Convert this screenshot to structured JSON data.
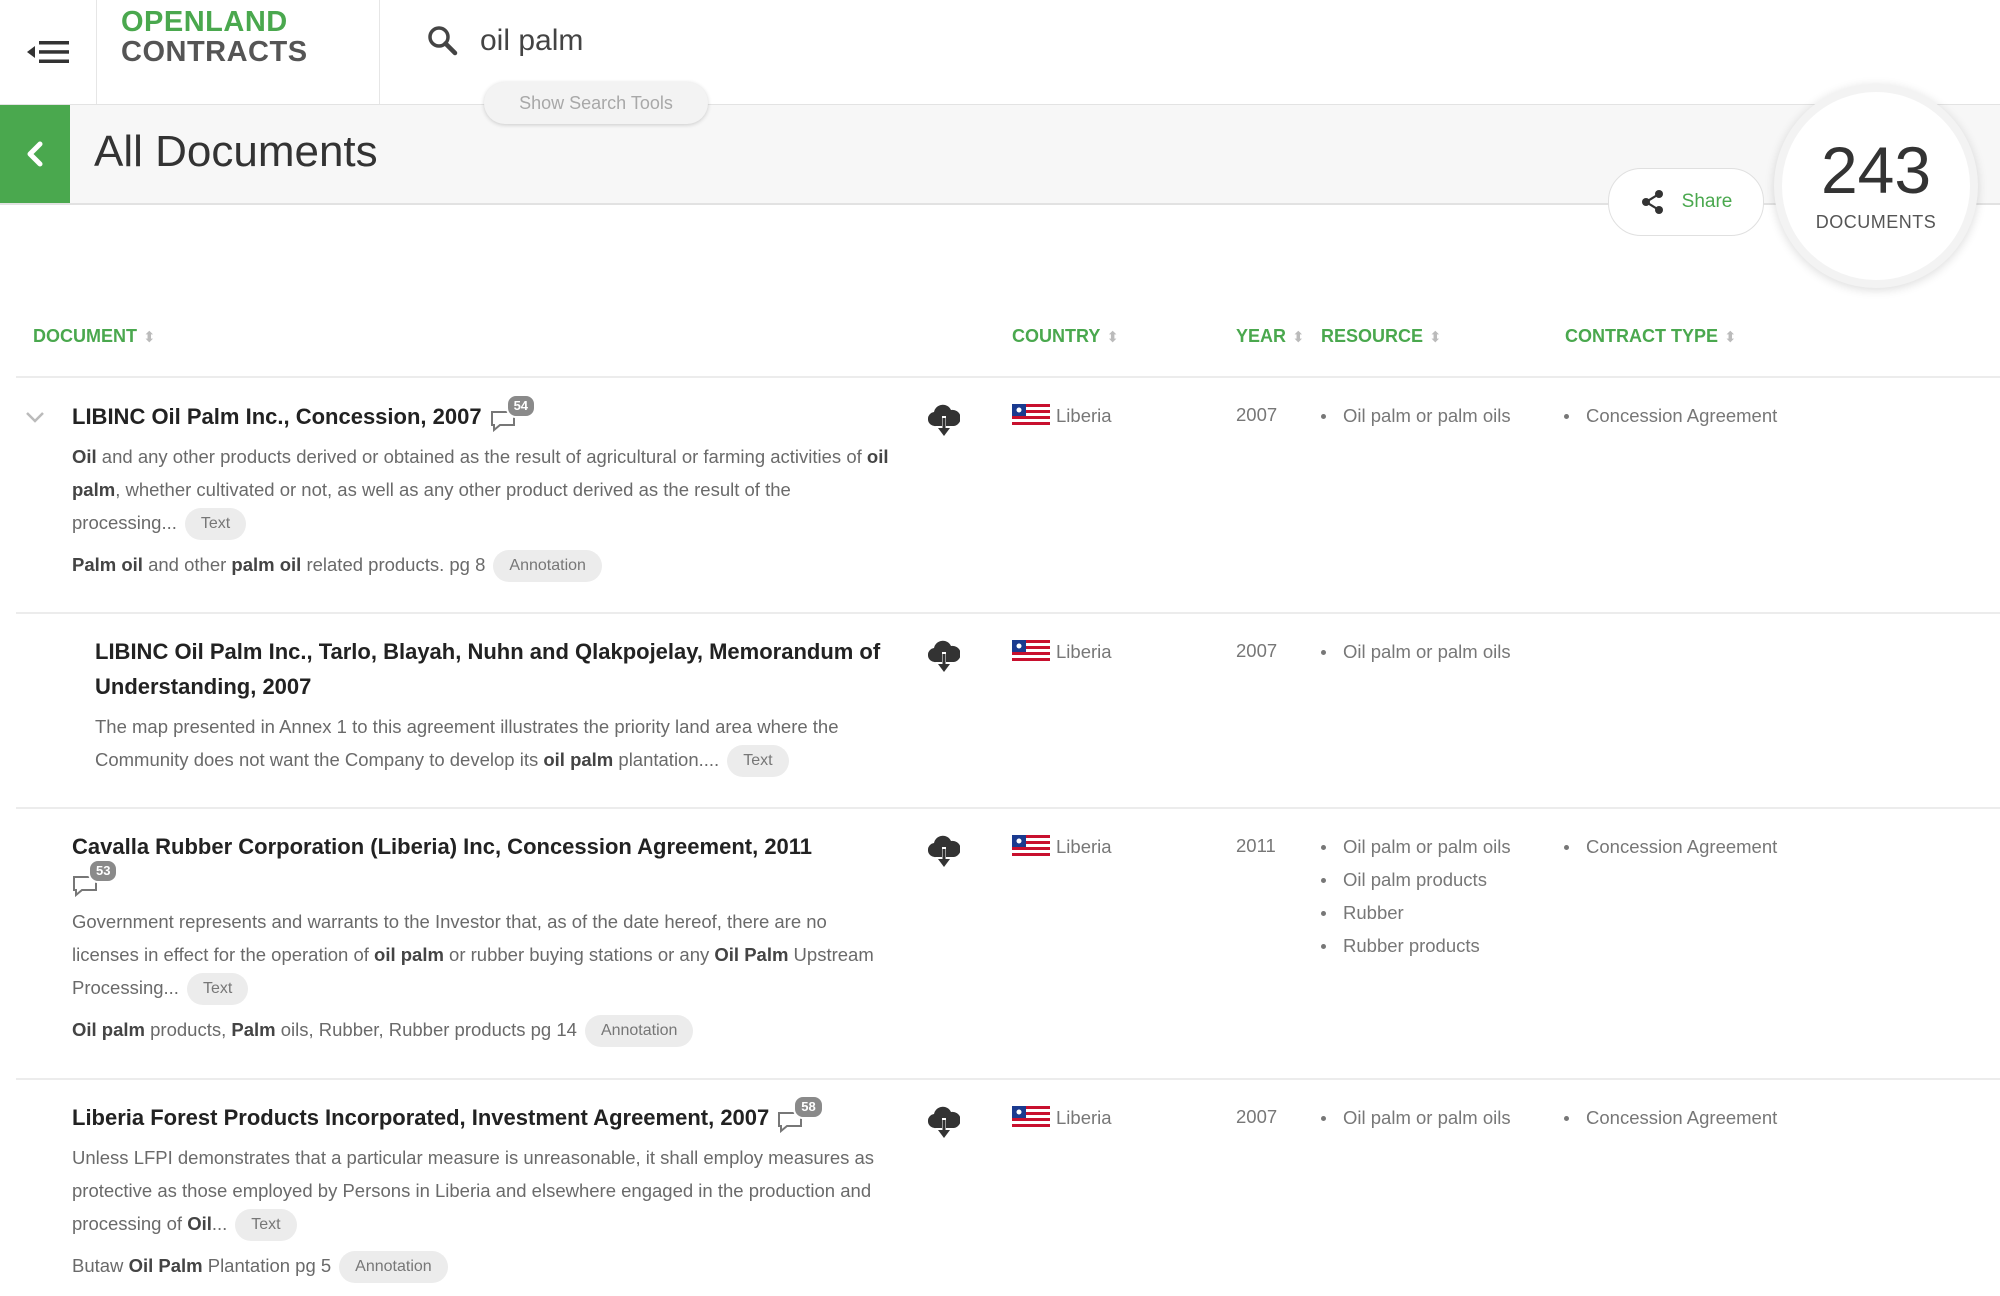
{
  "header": {
    "logo_line1": "OPENLAND",
    "logo_line2": "CONTRACTS",
    "search_value": "oil palm",
    "search_tools_label": "Show Search Tools"
  },
  "page": {
    "title": "All Documents",
    "share_label": "Share",
    "count": "243",
    "count_label": "DOCUMENTS"
  },
  "table": {
    "columns": [
      "DOCUMENT",
      "COUNTRY",
      "YEAR",
      "RESOURCE",
      "CONTRACT TYPE"
    ]
  },
  "rows": [
    {
      "title": "LIBINC Oil Palm Inc., Concession, 2007",
      "comments": "54",
      "snippet_html": "<b>Oil</b> and any other products derived or obtained as the result of agricultural or farming activities of <b>oil palm</b>, whether cultivated or not, as well as any other product derived as the result of the processing...",
      "snippet_tag": "Text",
      "annotation_html": "<b>Palm oil</b> and other <b>palm oil</b> related products. pg 8",
      "annotation_tag": "Annotation",
      "country": "Liberia",
      "year": "2007",
      "resources": [
        "Oil palm or palm oils"
      ],
      "contract_types": [
        "Concession Agreement"
      ]
    },
    {
      "title": "LIBINC Oil Palm Inc., Tarlo, Blayah, Nuhn and Qlakpojelay, Memorandum of Understanding, 2007",
      "snippet_html": "The map presented in Annex 1 to this agreement illustrates the priority land area where the Community does not want the Company to develop its <b>oil palm</b> plantation....",
      "snippet_tag": "Text",
      "country": "Liberia",
      "year": "2007",
      "resources": [
        "Oil palm or palm oils"
      ],
      "contract_types": []
    },
    {
      "title": "Cavalla Rubber Corporation (Liberia) Inc, Concession Agreement, 2011",
      "comments": "53",
      "snippet_html": "Government represents and warrants to the Investor that, as of the date hereof, there are no licenses in effect for the operation of <b>oil palm</b> or rubber buying stations or any <b>Oil Palm</b> Upstream Processing...",
      "snippet_tag": "Text",
      "annotation_html": "<b>Oil palm</b> products, <b>Palm</b> oils, Rubber, Rubber products pg 14",
      "annotation_tag": "Annotation",
      "country": "Liberia",
      "year": "2011",
      "resources": [
        "Oil palm or palm oils",
        "Oil palm products",
        "Rubber",
        "Rubber products"
      ],
      "contract_types": [
        "Concession Agreement"
      ]
    },
    {
      "title": "Liberia Forest Products Incorporated, Investment Agreement, 2007",
      "comments": "58",
      "snippet_html": "Unless LFPI demonstrates that a particular measure is unreasonable, it shall employ measures as protective as those employed by Persons in Liberia and elsewhere engaged in the production and processing of <b>Oil</b>...",
      "snippet_tag": "Text",
      "annotation_html": "Butaw <b>Oil Palm</b> Plantation pg 5",
      "annotation_tag": "Annotation",
      "country": "Liberia",
      "year": "2007",
      "resources": [
        "Oil palm or palm oils"
      ],
      "contract_types": [
        "Concession Agreement"
      ]
    }
  ]
}
